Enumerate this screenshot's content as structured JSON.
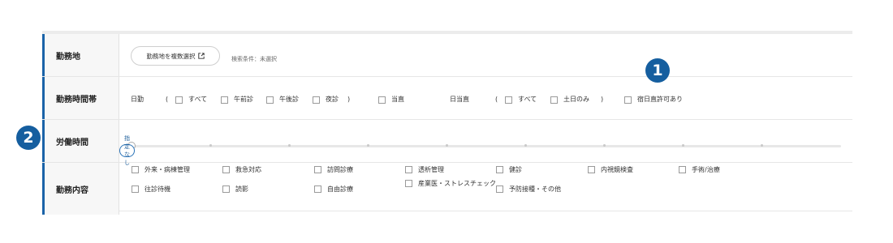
{
  "rows": {
    "location": {
      "label": "勤務地",
      "multi_select_button": "勤務地を複数選択",
      "search_condition": "検索条件：未選択"
    },
    "time_slot": {
      "label": "勤務時間帯",
      "day_label": "日勤",
      "open_paren": "(",
      "close_paren": ")",
      "day_options": [
        "すべて",
        "午前診",
        "午後診",
        "夜診"
      ],
      "on_duty": "当直",
      "day_on_duty_label": "日当直",
      "day_on_duty_options": [
        "すべて",
        "土日のみ"
      ],
      "overnight": "宿日直許可あり"
    },
    "work_hours": {
      "label": "労働時間",
      "slider_value": "指定なし",
      "slider_level": 0
    },
    "duties": {
      "label": "勤務内容",
      "items": [
        "外来・病棟管理",
        "救急対応",
        "訪問診療",
        "透析管理",
        "健診",
        "内視鏡検査",
        "手術/治療",
        "往診待機",
        "読影",
        "自由診療",
        "産業医・ストレスチェック",
        "予防接種・その他"
      ]
    }
  },
  "callouts": [
    "1",
    "2"
  ],
  "colors": {
    "accent": "#1a63a8",
    "callout": "#155e9f"
  },
  "icons": {
    "external": "external-link-icon"
  }
}
